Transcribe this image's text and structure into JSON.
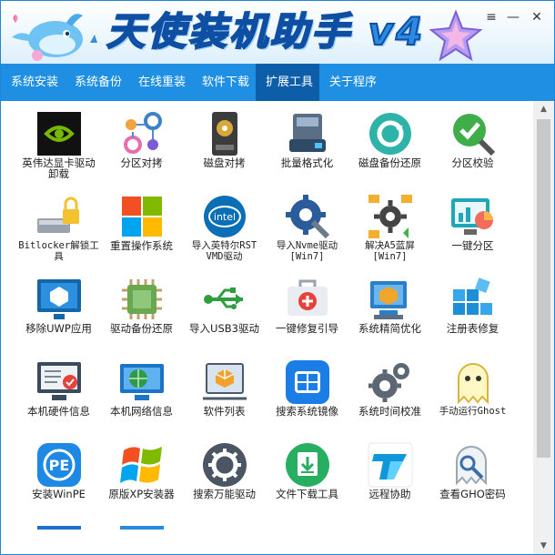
{
  "app": {
    "title": "天使装机助手 v4",
    "controls": {
      "menu_icon": "≡",
      "minimize": "—",
      "close": "✕"
    }
  },
  "menu": [
    {
      "label": "系统安装"
    },
    {
      "label": "系统备份"
    },
    {
      "label": "在线重装"
    },
    {
      "label": "软件下载"
    },
    {
      "label": "扩展工具",
      "active": true
    },
    {
      "label": "关于程序"
    }
  ],
  "tools": [
    {
      "label": "英伟达显卡驱动卸载",
      "icon": "nvidia-icon"
    },
    {
      "label": "分区对拷",
      "icon": "partition-copy-icon"
    },
    {
      "label": "磁盘对拷",
      "icon": "disk-copy-icon"
    },
    {
      "label": "批量格式化",
      "icon": "batch-format-icon"
    },
    {
      "label": "磁盘备份还原",
      "icon": "disk-backup-restore-icon"
    },
    {
      "label": "分区校验",
      "icon": "partition-check-icon"
    },
    {
      "label": "Bitlocker解锁工具",
      "icon": "bitlocker-unlock-icon"
    },
    {
      "label": "重置操作系统",
      "icon": "windows-logo-icon"
    },
    {
      "label": "导入英特尔RST VMD驱动",
      "icon": "intel-icon"
    },
    {
      "label": "导入Nvme驱动 [Win7]",
      "icon": "nvme-driver-icon"
    },
    {
      "label": "解决A5蓝屏 [Win7]",
      "icon": "bluescreen-fix-icon"
    },
    {
      "label": "一键分区",
      "icon": "one-click-partition-icon"
    },
    {
      "label": "移除UWP应用",
      "icon": "remove-uwp-icon"
    },
    {
      "label": "驱动备份还原",
      "icon": "driver-backup-icon"
    },
    {
      "label": "导入USB3驱动",
      "icon": "usb-icon"
    },
    {
      "label": "一键修复引导",
      "icon": "boot-repair-icon"
    },
    {
      "label": "系统精简优化",
      "icon": "system-optimize-icon"
    },
    {
      "label": "注册表修复",
      "icon": "registry-repair-icon"
    },
    {
      "label": "本机硬件信息",
      "icon": "hardware-info-icon"
    },
    {
      "label": "本机网络信息",
      "icon": "network-info-icon"
    },
    {
      "label": "软件列表",
      "icon": "software-list-icon"
    },
    {
      "label": "搜索系统镜像",
      "icon": "search-image-icon"
    },
    {
      "label": "系统时间校准",
      "icon": "time-sync-icon"
    },
    {
      "label": "手动运行Ghost",
      "icon": "ghost-icon"
    },
    {
      "label": "安装WinPE",
      "icon": "winpe-icon"
    },
    {
      "label": "原版XP安装器",
      "icon": "windows-xp-icon"
    },
    {
      "label": "搜索万能驱动",
      "icon": "universal-driver-icon"
    },
    {
      "label": "文件下载工具",
      "icon": "file-download-icon"
    },
    {
      "label": "远程协助",
      "icon": "remote-assist-icon"
    },
    {
      "label": "查看GHO密码",
      "icon": "gho-password-icon"
    }
  ],
  "scrollbar": {
    "up": "▲",
    "down": "▼"
  }
}
